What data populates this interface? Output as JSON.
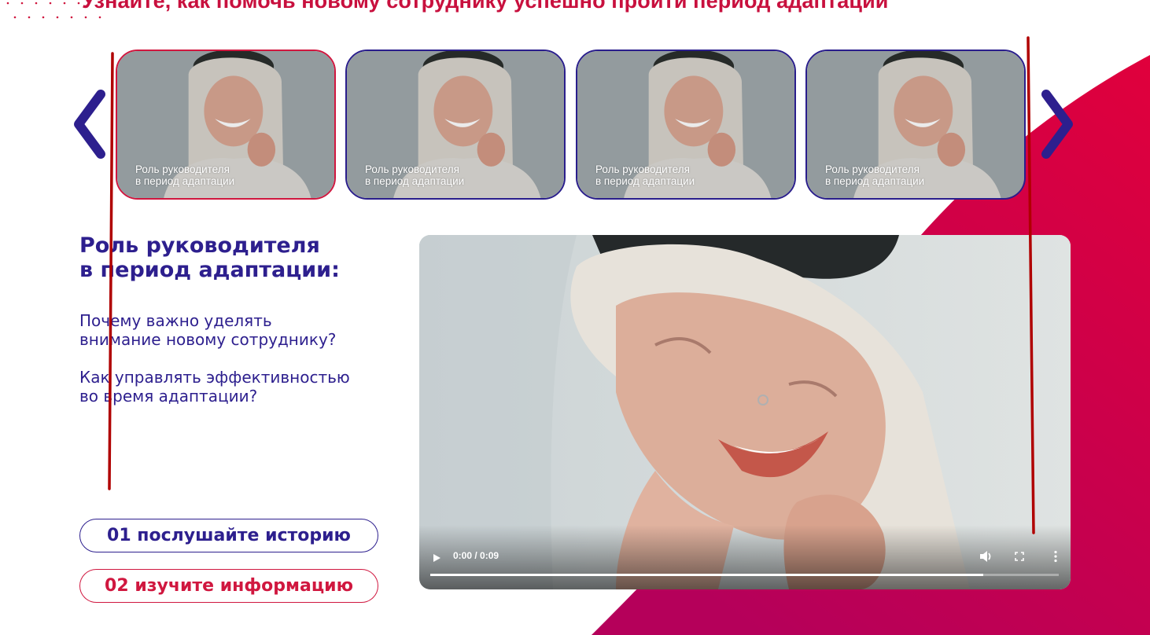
{
  "page": {
    "headline": "Узнайте, как помочь новому сотруднику успешно пройти период адаптации"
  },
  "carousel": {
    "items": [
      {
        "caption_line1": "Роль руководителя",
        "caption_line2": "в период адаптации",
        "active": true
      },
      {
        "caption_line1": "Роль руководителя",
        "caption_line2": "в период адаптации",
        "active": false
      },
      {
        "caption_line1": "Роль руководителя",
        "caption_line2": "в период адаптации",
        "active": false
      },
      {
        "caption_line1": "Роль руководителя",
        "caption_line2": "в период адаптации",
        "active": false
      }
    ],
    "prev_icon": "chevron-left-icon",
    "next_icon": "chevron-right-icon"
  },
  "content": {
    "title_line1": "Роль руководителя",
    "title_line2": "в период адаптации:",
    "question1_line1": "Почему важно уделять",
    "question1_line2": "внимание новому сотруднику?",
    "question2_line1": "Как управлять эффективностью",
    "question2_line2": "во время адаптации?"
  },
  "steps": {
    "step1_label": "01 послушайте историю",
    "step2_label": "02 изучите информацию"
  },
  "video": {
    "time": "0:00 / 0:09",
    "progress": 0.88,
    "play_icon": "play-icon",
    "volume_icon": "volume-icon",
    "fullscreen_icon": "fullscreen-icon",
    "menu_icon": "more-vertical-icon"
  },
  "colors": {
    "brand_blue": "#2d1f8e",
    "brand_red": "#d0173f",
    "annotation_red": "#b00000"
  }
}
